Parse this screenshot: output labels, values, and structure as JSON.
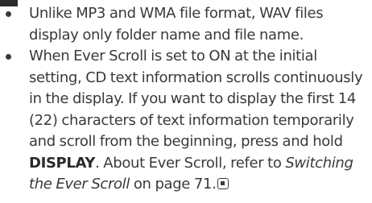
{
  "bullets": [
    {
      "text": "Unlike MP3 and WMA file format, WAV files display only folder name and file name."
    },
    {
      "text_1": "When Ever Scroll is set to ON at the initial setting, CD text information scrolls continuously in the display. If you want to display the first 14 (22) characters of text information temporarily and scroll from the beginning, press and hold ",
      "key_label": "DISPLAY",
      "text_2": ". About Ever Scroll, refer to ",
      "link_text": "Switching the Ever Scroll",
      "text_3": " on page 71."
    }
  ],
  "end_mark_icon": "end-of-section-icon"
}
